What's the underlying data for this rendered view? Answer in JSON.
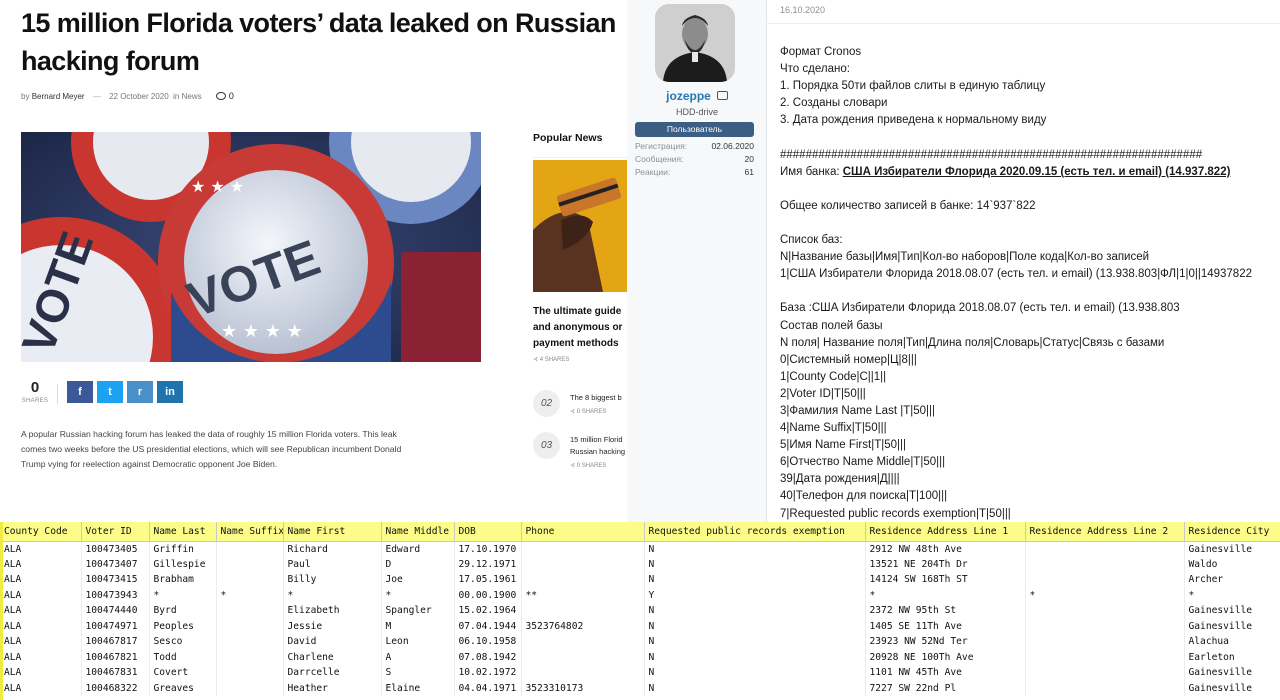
{
  "article": {
    "title": "15 million Florida voters’ data leaked on Russian hacking forum",
    "by_label": "by",
    "author": "Bernard Meyer",
    "date": "22 October 2020",
    "in_label": "in",
    "category": "News",
    "comments": "0",
    "shares_count": "0",
    "shares_label": "SHARES",
    "share_buttons": [
      {
        "name": "facebook",
        "glyph": "f",
        "color": "#3b5998"
      },
      {
        "name": "twitter",
        "glyph": "t",
        "color": "#1da1f2"
      },
      {
        "name": "reddit",
        "glyph": "r",
        "color": "#4a90c8"
      },
      {
        "name": "linkedin",
        "glyph": "in",
        "color": "#1f74ad"
      }
    ],
    "hero_buttons": [
      "VOTE",
      "VOTE"
    ],
    "lead": "A popular Russian hacking forum has leaked the data of roughly 15 million Florida voters. This leak comes two weeks before the US presidential elections, which will see Republican incumbent Donald Trump vying for reelection against Democratic opponent Joe Biden.",
    "lead_lines": [
      "A popular Russian hacking forum has leaked the data of roughly 15 million Florida voters. This leak",
      "comes two weeks before the US presidential elections, which will see Republican incumbent Donald",
      "Trump vying for reelection against Democratic opponent Joe Biden."
    ]
  },
  "popular": {
    "heading": "Popular News",
    "feature_lines": [
      "The ultimate guide",
      "and anonymous or",
      "payment methods"
    ],
    "feature_shares": "4 SHARES",
    "items": [
      {
        "num": "02",
        "lines": [
          "The 8 biggest b"
        ],
        "shares": "0 SHARES"
      },
      {
        "num": "03",
        "lines": [
          "15 million Florid",
          "Russian hacking"
        ],
        "shares": "0 SHARES"
      }
    ]
  },
  "forum": {
    "username": "jozeppe",
    "user_title": "HDD-drive",
    "banner": "Пользователь",
    "stats": [
      {
        "label": "Регистрация:",
        "value": "02.06.2020"
      },
      {
        "label": "Сообщения:",
        "value": "20"
      },
      {
        "label": "Реакции:",
        "value": "61"
      }
    ],
    "post_date": "16.10.2020",
    "lines": [
      "Формат Cronos",
      "Что сделано:",
      "1. Порядка 50ти файлов слиты в единую таблицу",
      "2. Созданы словари",
      "3. Дата рождения приведена к нормальному виду",
      "",
      "##################################################################",
      "Имя банка: ",
      "",
      "Общее количество записей в банке: 14`937`822",
      "",
      "Список баз:",
      "N|Название базы|Имя|Тип|Кол-во наборов|Поле кода|Кол-во записей",
      "1|США Избиратели Флорида 2018.08.07 (есть тел. и email) (13.938.803|ФЛ|1|0||14937822",
      "",
      "База :США Избиратели Флорида 2018.08.07 (есть тел. и email) (13.938.803",
      "Состав полей базы",
      "N поля| Название поля|Тип|Длина поля|Словарь|Статус|Связь с базами",
      "0|Системный номер|Ц|8|||",
      "1|County Code|С||1||",
      "2|Voter ID|Т|50|||",
      "3|Фамилия Name Last |Т|50|||",
      "4|Name Suffix|Т|50|||",
      "5|Имя Name First|Т|50|||",
      "6|Отчество Name Middle|Т|50|||",
      "39|Дата рождения|Д||||",
      "40|Телефон для поиска|Т|100|||",
      "7|Requested public records exemption|Т|50|||"
    ],
    "bank_name_link": "США Избиратели Флорида 2020.09.15 (есть тел. и email) (14.937.822)"
  },
  "sheet": {
    "headers": [
      "County Code",
      "Voter ID",
      "Name Last",
      "Name Suffix",
      "Name First",
      "Name Middle",
      "DOB",
      "Phone",
      "Requested public records exemption",
      "Residence Address Line 1",
      "Residence Address Line 2",
      "Residence City"
    ],
    "rows": [
      [
        "ALA",
        "100473405",
        "Griffin",
        "",
        "Richard",
        "Edward",
        "17.10.1970",
        "",
        "N",
        "2912 NW 48th Ave",
        "",
        "Gainesville"
      ],
      [
        "ALA",
        "100473407",
        "Gillespie",
        "",
        "Paul",
        "D",
        "29.12.1971",
        "",
        "N",
        "13521 NE 204Th Dr",
        "",
        "Waldo"
      ],
      [
        "ALA",
        "100473415",
        "Brabham",
        "",
        "Billy",
        "Joe",
        "17.05.1961",
        "",
        "N",
        "14124 SW 168Th ST",
        "",
        "Archer"
      ],
      [
        "ALA",
        "100473943",
        "*",
        "*",
        "*",
        "*",
        "00.00.1900",
        "**",
        "Y",
        "*",
        "*",
        "*"
      ],
      [
        "ALA",
        "100474440",
        "Byrd",
        "",
        "Elizabeth",
        "Spangler",
        "15.02.1964",
        "",
        "N",
        "2372 NW 95th St",
        "",
        "Gainesville"
      ],
      [
        "ALA",
        "100474971",
        "Peoples",
        "",
        "Jessie",
        "M",
        "07.04.1944",
        "3523764802",
        "N",
        "1405 SE 11Th Ave",
        "",
        "Gainesville"
      ],
      [
        "ALA",
        "100467817",
        "Sesco",
        "",
        "David",
        "Leon",
        "06.10.1958",
        "",
        "N",
        "23923 NW 52Nd Ter",
        "",
        "Alachua"
      ],
      [
        "ALA",
        "100467821",
        "Todd",
        "",
        "Charlene",
        "A",
        "07.08.1942",
        "",
        "N",
        "20928 NE 100Th Ave",
        "",
        "Earleton"
      ],
      [
        "ALA",
        "100467831",
        "Covert",
        "",
        "Darrcelle",
        "S",
        "10.02.1972",
        "",
        "N",
        "1101 NW 45Th Ave",
        "",
        "Gainesville"
      ],
      [
        "ALA",
        "100468322",
        "Greaves",
        "",
        "Heather",
        "Elaine",
        "04.04.1971",
        "3523310173",
        "N",
        "7227 SW 22nd Pl",
        "",
        "Gainesville"
      ]
    ]
  }
}
